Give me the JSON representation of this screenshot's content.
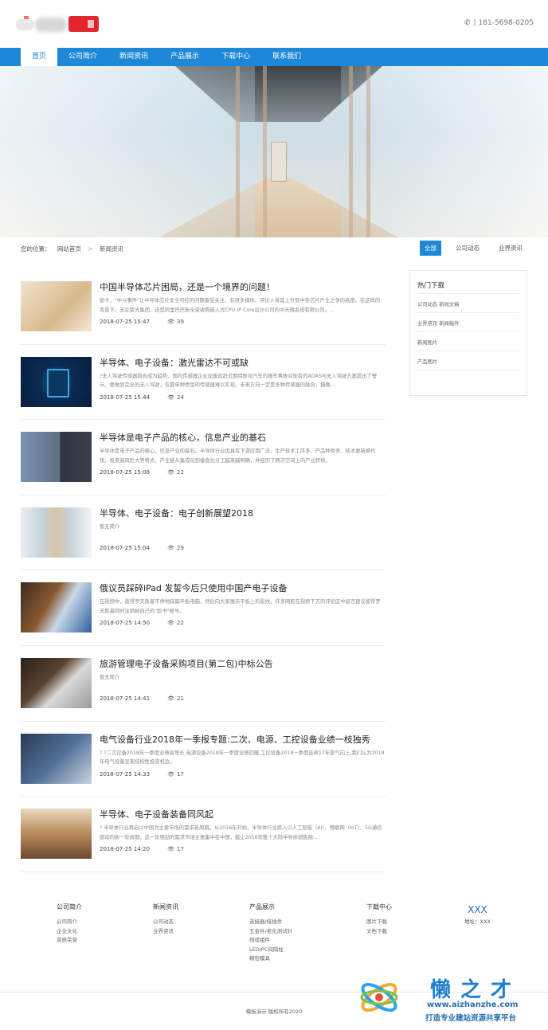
{
  "header": {
    "phone": "181-5698-0205"
  },
  "nav": {
    "items": [
      "首页",
      "公司简介",
      "新闻资讯",
      "产品展示",
      "下载中心",
      "联系我们"
    ]
  },
  "breadcrumb": {
    "label": "您的位置：",
    "home": "网站首页",
    "sep": ">",
    "current": "新闻资讯"
  },
  "category_tabs": [
    "全部",
    "公司动态",
    "业界资讯"
  ],
  "news": [
    {
      "title": "中国半导体芯片困局，还是一个境界的问题！",
      "desc": "如今，\"中兴事件\"让半导体芯片安全可控的问题备受关注，有很多媒体、评论人将其上升到中美芯片产业之争的高度。在这样的背景下，无论紫光集团、还是阿里巴巴斩全资收购嵌入式CPU IP Core设计公司的中天微系统有限公司，...",
      "date": "2018-07-25 15:47",
      "views": "39"
    },
    {
      "title": "半导体、电子设备：激光雷达不可或缺",
      "desc": "?无人驾驶传感器融合成为趋势，国内传感器企业加速追赶近期特斯拉汽车的撞车事故对现有的ADAS与无人驾驶方案提出了警示，要做到完全的无人驾驶，仅靠单种类型的传感器难以实现。未来方向一定是多种传感器的融合，摄像...",
      "date": "2018-07-25 15:44",
      "views": "24"
    },
    {
      "title": "半导体是电子产品的核心，信息产业的基石",
      "desc": "半导体是电子产品的核心，信息产业的基石。半导体行业因具有下游应用广泛、生产技术工序多、产品种类多、技术更新换代快、投资高风险大等特点，产业链从集成化到垂直化分工越来越明确，并经历了两次空间上的产业转移。",
      "date": "2018-07-25 15:08",
      "views": "22"
    },
    {
      "title": "半导体、电子设备：电子创新展望2018",
      "desc": "暂无简介",
      "date": "2018-07-25 15:04",
      "views": "29"
    },
    {
      "title": "俄议员踩碎iPad 发誓今后只使用中国产电子设备",
      "desc": "在视频中，彼得罗夫斯基不停地踩踏平板电脑，然后向大家展示平板上的裂纹。许多网民在视频下方的评论区中留言建议彼得罗夫斯基同时注销掉自己的\"脸书\"帐号。",
      "date": "2018-07-25 14:50",
      "views": "22"
    },
    {
      "title": "旅游管理电子设备采购项目(第二包)中标公告",
      "desc": "暂无简介",
      "date": "2018-07-25 14:41",
      "views": "21"
    },
    {
      "title": "电气设备行业2018年一季报专题:二次、电源、工控设备业绩一枝独秀",
      "desc": "? ?二次设备2018年一季度业绩高增长,电源设备2018年一季度业绩回暖,工控设备2018一季度延续17年景气向上,我们认为2018年电气设备呈现结构性投资机会。",
      "date": "2018-07-25 14:33",
      "views": "17"
    },
    {
      "title": "半导体、电子设备装备同风起",
      "desc": "? 半导体行业再启以中国为主要市场的需求新周期。从2016年开始，半导体行业跨入以人工智能（AI）、物联网（IoT）、5G通信驱动的新一轮周期。这一轮强劲的需求市场主要集中在中国，截止2016年整个大陆半导体销售额...",
      "date": "2018-07-25 14:20",
      "views": "17"
    }
  ],
  "sidebar": {
    "title": "热门下载",
    "links": [
      "公司动态 新闻文稿",
      "业界资讯 新闻稿件",
      "新闻图片",
      "产品图片"
    ]
  },
  "footer": {
    "cols": [
      {
        "title": "公司简介",
        "links": [
          "公司简介",
          "企业文化",
          "资质荣誉"
        ]
      },
      {
        "title": "新闻资讯",
        "links": [
          "公司动态",
          "业界资讯"
        ]
      },
      {
        "title": "产品展示",
        "links": [
          "连接器/接插件",
          "五金件/老化测试针",
          "线缆组件",
          "LED/PC间隔柱",
          "精密模具"
        ]
      },
      {
        "title": "下载中心",
        "links": [
          "图片下载",
          "文档下载"
        ]
      }
    ],
    "contact_name": "XXX",
    "contact_addr": "地址：XXX",
    "copyright": "模板演示 版权所有2020"
  },
  "watermark": {
    "cn": "懒之才",
    "url": "www.aizhanzhe.com",
    "slogan": "打造专业建站资源共享平台"
  }
}
